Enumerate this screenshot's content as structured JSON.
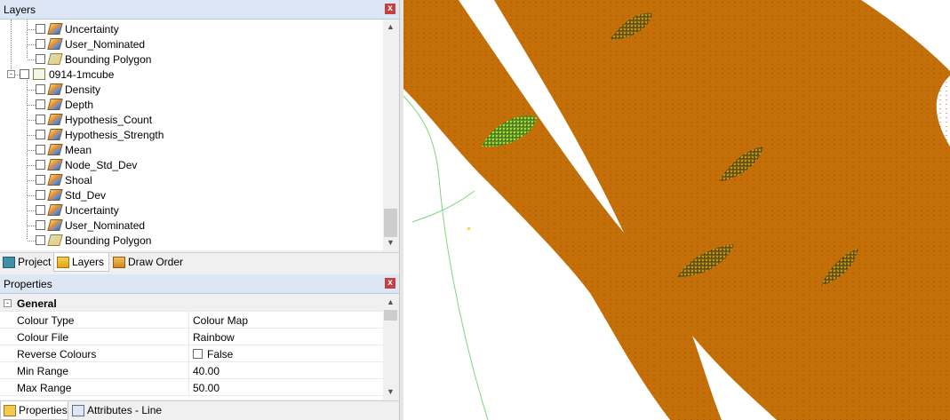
{
  "layers_panel": {
    "title": "Layers",
    "close": "x",
    "items": [
      {
        "label": "Uncertainty",
        "icon": "raster-layer-icon",
        "level": 2
      },
      {
        "label": "User_Nominated",
        "icon": "raster-layer-icon",
        "level": 2
      },
      {
        "label": "Bounding Polygon",
        "icon": "polygon-layer-icon",
        "level": 2
      },
      {
        "label": "0914-1mcube",
        "icon": "surface-group-icon",
        "level": 1,
        "expander": "-"
      },
      {
        "label": "Density",
        "icon": "raster-layer-icon",
        "level": 2
      },
      {
        "label": "Depth",
        "icon": "raster-layer-icon",
        "level": 2
      },
      {
        "label": "Hypothesis_Count",
        "icon": "raster-layer-icon",
        "level": 2
      },
      {
        "label": "Hypothesis_Strength",
        "icon": "raster-layer-icon",
        "level": 2
      },
      {
        "label": "Mean",
        "icon": "raster-layer-icon",
        "level": 2
      },
      {
        "label": "Node_Std_Dev",
        "icon": "raster-layer-icon",
        "level": 2
      },
      {
        "label": "Shoal",
        "icon": "raster-layer-icon",
        "level": 2
      },
      {
        "label": "Std_Dev",
        "icon": "raster-layer-icon",
        "level": 2
      },
      {
        "label": "Uncertainty",
        "icon": "raster-layer-icon",
        "level": 2
      },
      {
        "label": "User_Nominated",
        "icon": "raster-layer-icon",
        "level": 2
      },
      {
        "label": "Bounding Polygon",
        "icon": "polygon-layer-icon",
        "level": 2
      }
    ],
    "scroll_position": 0.88
  },
  "dock_tabs": [
    {
      "label": "Project",
      "icon": "project-icon"
    },
    {
      "label": "Layers",
      "icon": "layers-icon",
      "active": true
    },
    {
      "label": "Draw Order",
      "icon": "draw-order-icon"
    }
  ],
  "properties_panel": {
    "title": "Properties",
    "close": "x",
    "group": "General",
    "group_expander": "-",
    "rows": [
      {
        "key": "Colour Type",
        "value": "Colour Map"
      },
      {
        "key": "Colour File",
        "value": "Rainbow"
      },
      {
        "key": "Reverse Colours",
        "value": "False",
        "checkbox": true
      },
      {
        "key": "Min Range",
        "value": "40.00"
      },
      {
        "key": "Max Range",
        "value": "50.00"
      }
    ]
  },
  "bottom_tabs": [
    {
      "label": "Properties",
      "icon": "properties-icon",
      "active": true
    },
    {
      "label": "Attributes - Line",
      "icon": "attributes-table-icon"
    }
  ],
  "scroll_arrows": {
    "up": "▲",
    "down": "▼"
  },
  "colors": {
    "surface": "#c46f08",
    "surface_dark": "#8c4e06",
    "feature_green": "#8fc23a",
    "polygon_line": "#7fd67f",
    "panel_header": "#dce6f4"
  }
}
